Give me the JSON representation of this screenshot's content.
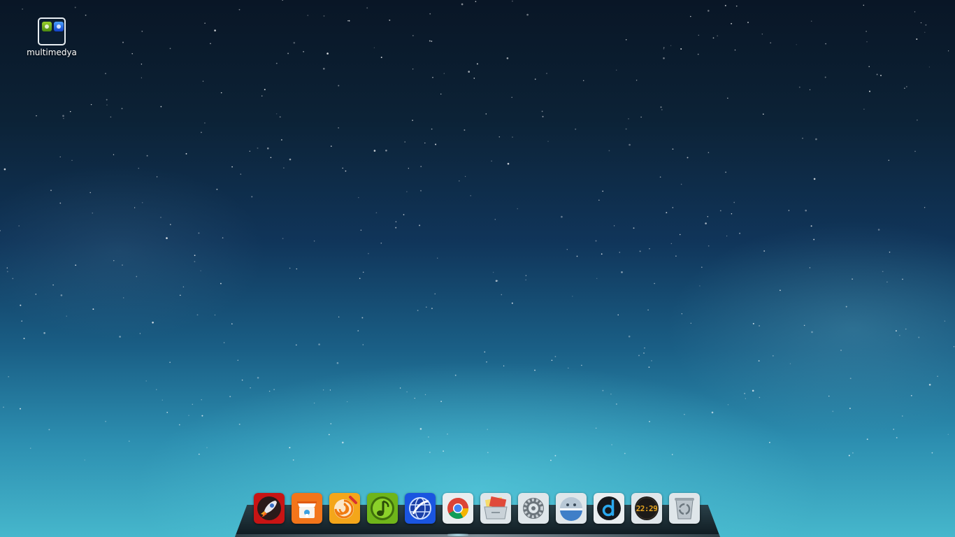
{
  "desktop": {
    "background": "starry-night-sky-wallpaper",
    "icons": [
      {
        "label": "multimedya",
        "icon": "folder-icon"
      }
    ]
  },
  "dock": {
    "items": [
      {
        "icon": "launcher-rocket-icon",
        "color": "#d81f1f"
      },
      {
        "icon": "app-store-icon",
        "color": "#f2751a"
      },
      {
        "icon": "media-player-icon",
        "color": "#f4a61a"
      },
      {
        "icon": "music-player-icon",
        "color": "#7cc21d"
      },
      {
        "icon": "web-browser-globe-icon",
        "color": "#1e5ce8"
      },
      {
        "icon": "chrome-browser-icon",
        "color": "#e9eef0"
      },
      {
        "icon": "file-manager-icon",
        "color": "#dfe6ea"
      },
      {
        "icon": "system-settings-icon",
        "color": "#dfe6ea"
      },
      {
        "icon": "terminal-robot-icon",
        "color": "#dfe6ea"
      },
      {
        "icon": "d-app-icon",
        "color": "#e9eef0"
      },
      {
        "icon": "clock-icon",
        "color": "#1c1a18",
        "time": "22:29"
      },
      {
        "icon": "trash-icon",
        "color": "#dfe6ea"
      }
    ]
  }
}
